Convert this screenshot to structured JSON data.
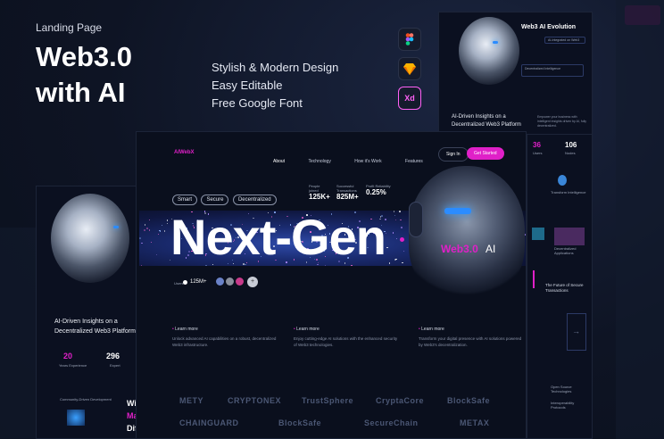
{
  "intro": {
    "subtitle": "Landing Page",
    "title_line1": "Web3.0",
    "title_line2": "with AI",
    "features": [
      "Stylish & Modern Design",
      "Easy Editable",
      "Free Google Font"
    ],
    "tools": [
      {
        "name": "figma-icon"
      },
      {
        "name": "sketch-icon"
      },
      {
        "name": "xd-icon",
        "label": "Xd"
      }
    ]
  },
  "right_card": {
    "title": "Web3 AI Evolution",
    "chip1": "AI-Integrated on Web3",
    "chip2": "Decentralized Intelligence",
    "heading": "AI-Driven Insights on a Decentralized Web3 Platform",
    "desc": "Empower your business with intelligent insights driven by AI, fully decentralized.",
    "stat1_value": "36",
    "stat1_label": "Users",
    "stat2_value": "106",
    "stat2_label": "Nodes",
    "item1": "Transform Intelligence",
    "item2": "Decentralized Applications",
    "item3": "The Future of Secure Transactions",
    "item4": "Open Source Technologies",
    "item5": "Interoperability Protocols"
  },
  "left_card": {
    "heading": "AI-Driven Insights on a Decentralized Web3 Platform",
    "stat1_value": "20",
    "stat1_label": "Years Experience",
    "stat2_value": "296",
    "stat2_label": "Expert",
    "item": "Community-Driven Development",
    "side1": "Wi",
    "side2": "Mak",
    "side3": "Diffe"
  },
  "main": {
    "logo": "AIWebX",
    "nav": [
      "About",
      "Technology",
      "How it's Work",
      "Features"
    ],
    "signin": "Sign In",
    "get_started": "Get Started",
    "tags": [
      "Smart",
      "Secure",
      "Decentralized"
    ],
    "stats": [
      {
        "label": "People joined",
        "value": "125K+"
      },
      {
        "label": "Successful Transactions",
        "value": "825M+"
      },
      {
        "label": "Profit Reliability",
        "value": "0.25%"
      }
    ],
    "hero_title": "Next-Gen",
    "hero_web3": "Web3.0",
    "hero_ai": "AI",
    "users_label": "Users",
    "users_value": "125M+",
    "learn": [
      {
        "label": "Learn more",
        "text": "Unlock advanced AI capabilities on a robust, decentralized Web3 infrastructure."
      },
      {
        "label": "Learn more",
        "text": "Enjoy cutting-edge AI solutions with the enhanced security of Web3 technologies."
      },
      {
        "label": "Learn more",
        "text": "Transform your digital presence with AI solutions powered by Web3's decentralization."
      }
    ],
    "brands_row1": [
      "METY",
      "CRYPTONEX",
      "TrustSphere",
      "CryptaCore",
      "BlockSafe"
    ],
    "brands_row2": [
      "CHAINGUARD",
      "BlockSafe",
      "SecureChain",
      "METAX"
    ]
  },
  "colors": {
    "accent": "#e020c8",
    "bg": "#0b1020"
  }
}
